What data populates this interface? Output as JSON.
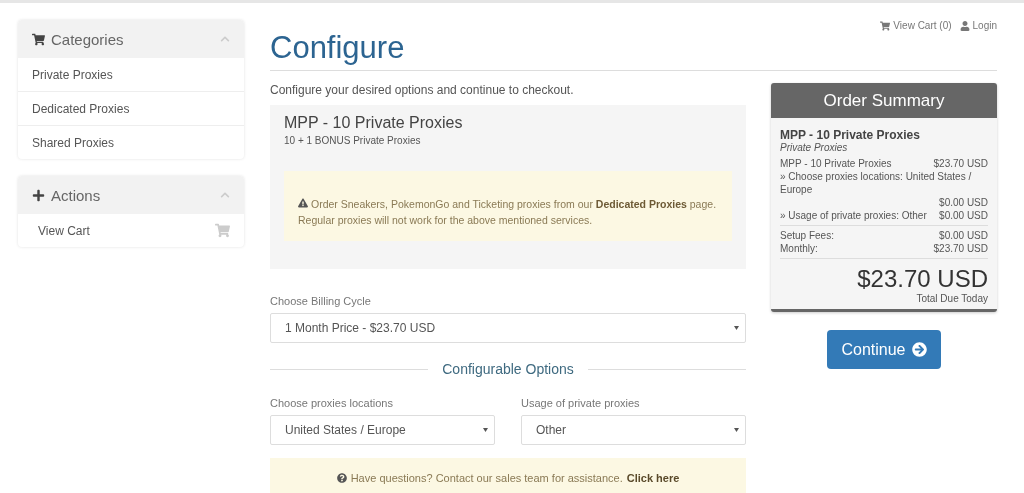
{
  "top_links": [
    {
      "kind": "cart",
      "label": "View Cart (0)"
    },
    {
      "kind": "user",
      "label": "Login"
    }
  ],
  "sidebar": [
    {
      "kind": "cart",
      "title": "Categories",
      "expanded": true,
      "items": [
        {
          "label": "Private Proxies"
        },
        {
          "label": "Dedicated Proxies"
        },
        {
          "label": "Shared Proxies"
        }
      ]
    },
    {
      "kind": "plus",
      "title": "Actions",
      "expanded": true,
      "items": [
        {
          "label": "View Cart",
          "kind": "cart"
        }
      ]
    }
  ],
  "page_title": "Configure",
  "intro": "Configure your desired options and continue to checkout.",
  "product": {
    "name": "MPP - 10 Private Proxies",
    "description": "10 + 1 BONUS Private Proxies",
    "notice": "Order Sneakers, PokemonGo and Ticketing proxies from our **Dedicated Proxies** page. Regular proxies will not work for the above mentioned services."
  },
  "billing": {
    "label": "Choose Billing Cycle",
    "value": "1 Month Price - $23.70 USD"
  },
  "options_heading": "Configurable Options",
  "options": [
    {
      "label": "Choose proxies locations",
      "value": "United States / Europe"
    },
    {
      "label": "Usage of private proxies",
      "value": "Other"
    }
  ],
  "help": {
    "text": "Have questions? Contact our sales team for assistance.",
    "link": "Click here"
  },
  "summary": {
    "title": "Order Summary",
    "product": "MPP - 10 Private Proxies",
    "group": "Private Proxies",
    "lines": [
      {
        "kind": "inline",
        "label": "MPP - 10 Private Proxies",
        "price": "$23.70 USD"
      },
      {
        "kind": "stacked",
        "label": "» Choose proxies locations: United States / Europe",
        "price": "$0.00 USD"
      },
      {
        "kind": "inline",
        "label": "» Usage of private proxies: Other",
        "price": "$0.00 USD"
      }
    ],
    "totals": [
      {
        "label": "Setup Fees:",
        "price": "$0.00 USD"
      },
      {
        "label": "Monthly:",
        "price": "$23.70 USD"
      }
    ],
    "total": "$23.70 USD",
    "total_label": "Total Due Today"
  },
  "continue_button": "Continue"
}
